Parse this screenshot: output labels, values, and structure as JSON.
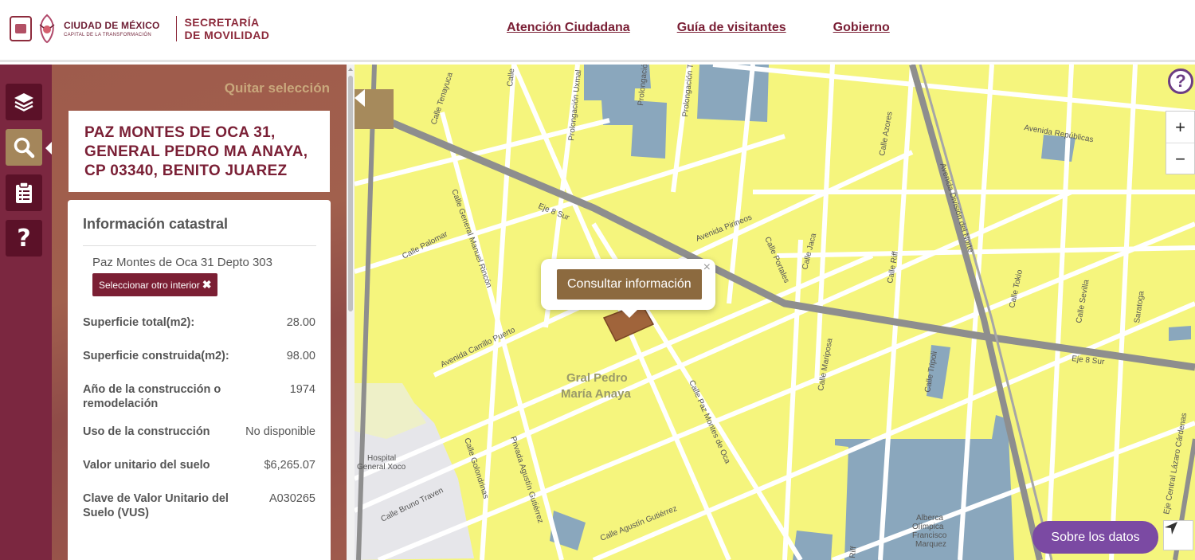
{
  "header": {
    "logo_name": "CIUDAD DE MÉXICO",
    "logo_sub": "CAPITAL DE LA TRANSFORMACIÓN",
    "secretaria_line1": "SECRETARÍA",
    "secretaria_line2": "DE MOVILIDAD",
    "nav": [
      "Atención Ciudadana",
      "Guía de visitantes",
      "Gobierno"
    ]
  },
  "rail": {
    "icons": [
      "layers-icon",
      "search-icon",
      "clipboard-icon",
      "help-icon"
    ],
    "active": "search-icon"
  },
  "panel": {
    "clear_label": "Quitar selección",
    "address_line1": "PAZ MONTES DE OCA 31,",
    "address_line2": "GENERAL PEDRO MA ANAYA,",
    "address_line3": "CP 03340, BENITO JUAREZ",
    "info_title": "Información catastral",
    "interior": "Paz Montes de Oca 31 Depto 303",
    "select_other_label": "Seleccionar otro interior",
    "select_other_icon": "close-icon",
    "rows": [
      {
        "label": "Superficie total(m2):",
        "value": "28.00"
      },
      {
        "label": "Superficie construida(m2):",
        "value": "98.00"
      },
      {
        "label": "Año de la construcción o remodelación",
        "value": "1974"
      },
      {
        "label": "Uso de la construcción",
        "value": "No disponible"
      },
      {
        "label": "Valor unitario del suelo",
        "value": "$6,265.07"
      },
      {
        "label": "Clave de Valor Unitario del Suelo (VUS)",
        "value": "A030265"
      }
    ]
  },
  "map": {
    "popup_button": "Consultar información",
    "popup_close": "×",
    "help_label": "?",
    "zoom_in": "+",
    "zoom_out": "−",
    "sobre_button": "Sobre los datos",
    "labels": {
      "neighborhood_1": "Gral Pedro",
      "neighborhood_2": "María Anaya",
      "hospital_1": "Hospital",
      "hospital_2": "General Xoco",
      "albercas_1": "Alberca",
      "albercas_2": "Olímpica",
      "albercas_3": "Francisco",
      "albercas_4": "Marquez",
      "eje8": "Eje 8 Sur",
      "eje8b": "Eje 8 Sur",
      "pirineos": "Avenida Pirineos",
      "republicas": "Avenida Repúblicas",
      "division": "Avenida División del Norte",
      "carrillo": "Avenida Carrillo Puerto",
      "paz_montes": "Calle Paz Montes de Oca",
      "palomar": "Calle Palomar",
      "gral_manuel": "Calle General Manuel Rincón",
      "portales": "Calle Portales",
      "ajusco": "Calle Jaca",
      "azores": "Calle Azores",
      "riff": "Calle Riff",
      "tokio": "Calle Tokio",
      "sevilla": "Calle Sevilla",
      "saratoga": "Saratoga",
      "mariposa": "Calle Mariposa",
      "tripoli": "Calle Tripoli",
      "golondrinas": "Calle Golondrinas",
      "privada": "Privada Agustín Gutiérrez",
      "agustin": "Calle Agustín Gutiérrez",
      "bruno": "Calle Bruno Traven",
      "tenayuca": "Calle Tenayuca",
      "prolongacion_uxmal": "Prolongación Uxmal",
      "prolongacion": "Prolongación",
      "prolongacion_t": "Prolongación Ta",
      "eje_central": "Eje Central Lázaro Cárdenas",
      "riff2": "Riff",
      "calle_c": "Calle"
    },
    "colors": {
      "land": "#f5f57d",
      "block": "#f7f764",
      "road": "#ffffff",
      "major_road": "#8e8e8e",
      "blue_zone": "#8aa7bd",
      "parcel": "#a0643b"
    }
  }
}
